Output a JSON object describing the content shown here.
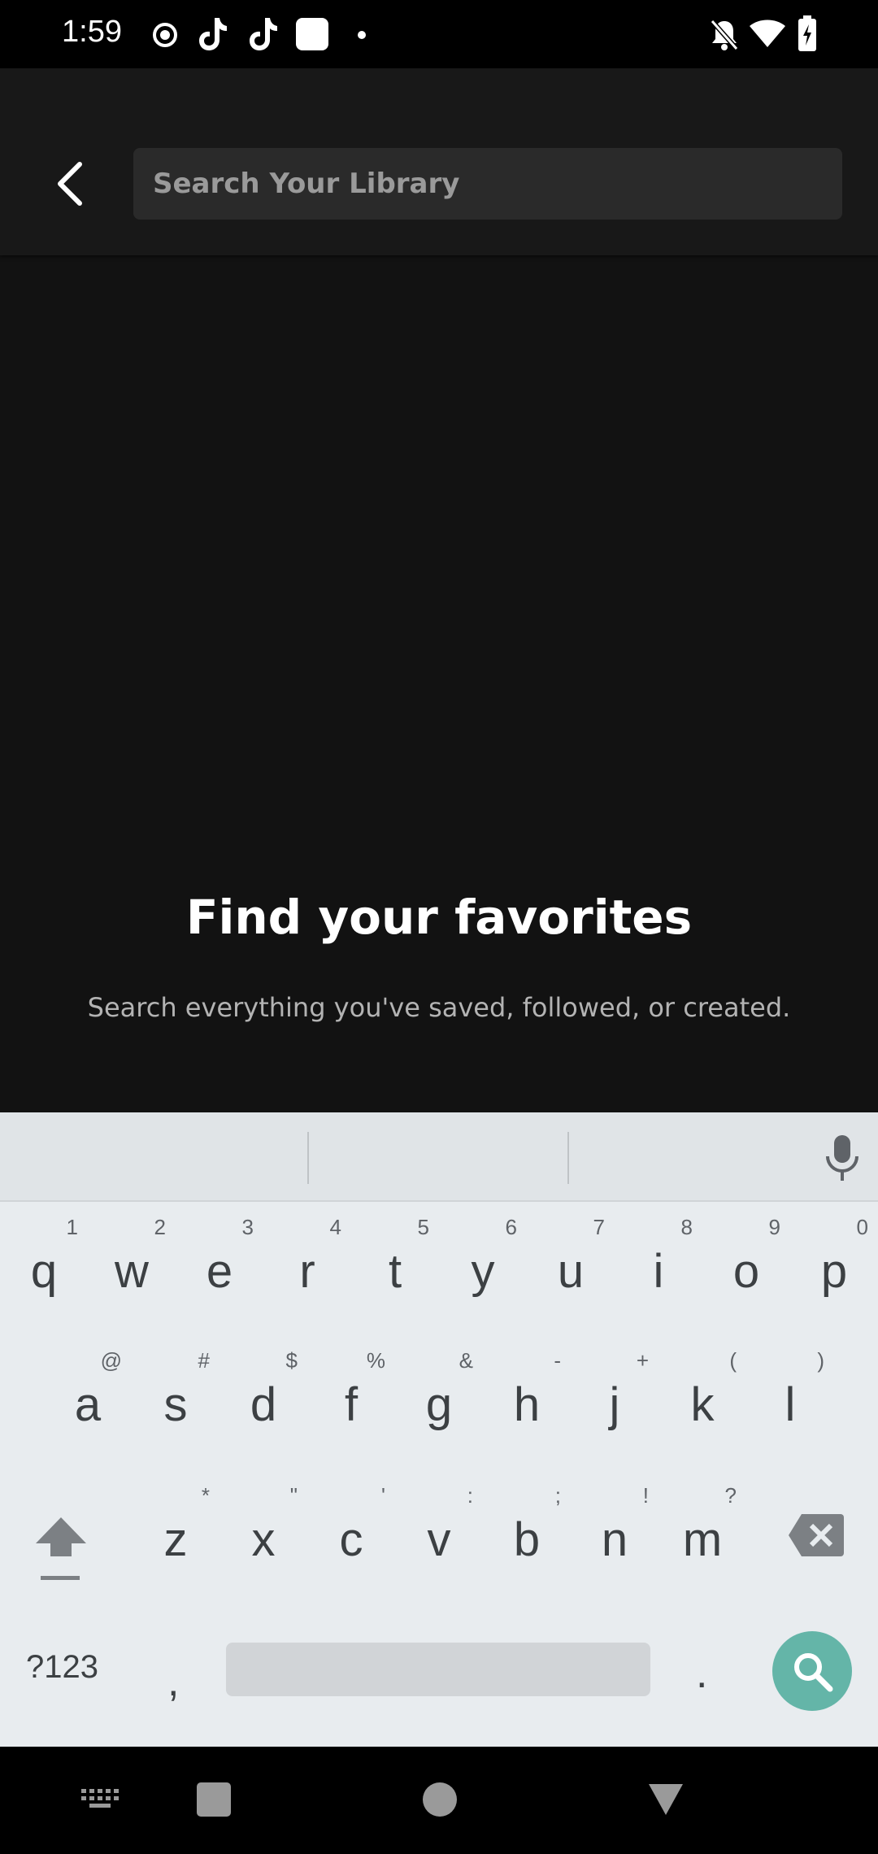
{
  "status_bar": {
    "time": "1:59"
  },
  "header": {
    "search_placeholder": "Search Your Library"
  },
  "empty_state": {
    "title": "Find your favorites",
    "subtitle": "Search everything you've saved, followed, or created."
  },
  "keyboard": {
    "row1": [
      {
        "k": "q",
        "h": "1"
      },
      {
        "k": "w",
        "h": "2"
      },
      {
        "k": "e",
        "h": "3"
      },
      {
        "k": "r",
        "h": "4"
      },
      {
        "k": "t",
        "h": "5"
      },
      {
        "k": "y",
        "h": "6"
      },
      {
        "k": "u",
        "h": "7"
      },
      {
        "k": "i",
        "h": "8"
      },
      {
        "k": "o",
        "h": "9"
      },
      {
        "k": "p",
        "h": "0"
      }
    ],
    "row2": [
      {
        "k": "a",
        "h": "@"
      },
      {
        "k": "s",
        "h": "#"
      },
      {
        "k": "d",
        "h": "$"
      },
      {
        "k": "f",
        "h": "%"
      },
      {
        "k": "g",
        "h": "&"
      },
      {
        "k": "h",
        "h": "-"
      },
      {
        "k": "j",
        "h": "+"
      },
      {
        "k": "k",
        "h": "("
      },
      {
        "k": "l",
        "h": ")"
      }
    ],
    "row3": [
      {
        "k": "z",
        "h": "*"
      },
      {
        "k": "x",
        "h": "\""
      },
      {
        "k": "c",
        "h": "'"
      },
      {
        "k": "v",
        "h": ":"
      },
      {
        "k": "b",
        "h": ";"
      },
      {
        "k": "n",
        "h": "!"
      },
      {
        "k": "m",
        "h": "?"
      }
    ],
    "symbols_label": "?123",
    "comma": ",",
    "period": "."
  }
}
